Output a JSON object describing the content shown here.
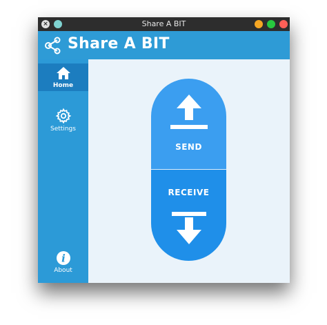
{
  "window": {
    "title": "Share A BIT",
    "controls": {
      "close_glyph": "×",
      "minimize_color": "#f5a623",
      "maximize_color": "#27c93f",
      "close_color": "#ff5f57",
      "pin_color": "#7fd3d1"
    }
  },
  "header": {
    "app_name": "Share A BIT",
    "logo_icon": "share-icon"
  },
  "sidebar": {
    "items": [
      {
        "label": "Home",
        "icon": "home-icon",
        "active": true
      },
      {
        "label": "Settings",
        "icon": "gear-icon",
        "active": false
      },
      {
        "label": "About",
        "icon": "info-icon",
        "active": false
      }
    ]
  },
  "actions": {
    "send_label": "SEND",
    "receive_label": "RECEIVE",
    "send_icon": "upload-arrow-icon",
    "receive_icon": "download-arrow-icon"
  },
  "colors": {
    "header": "#2e9bd6",
    "sidebar": "#2c9ad7",
    "sidebar_active": "#1c7dbf",
    "send": "#3b9ef0",
    "receive": "#1f8fe9",
    "content_bg": "#eaf3fa"
  }
}
